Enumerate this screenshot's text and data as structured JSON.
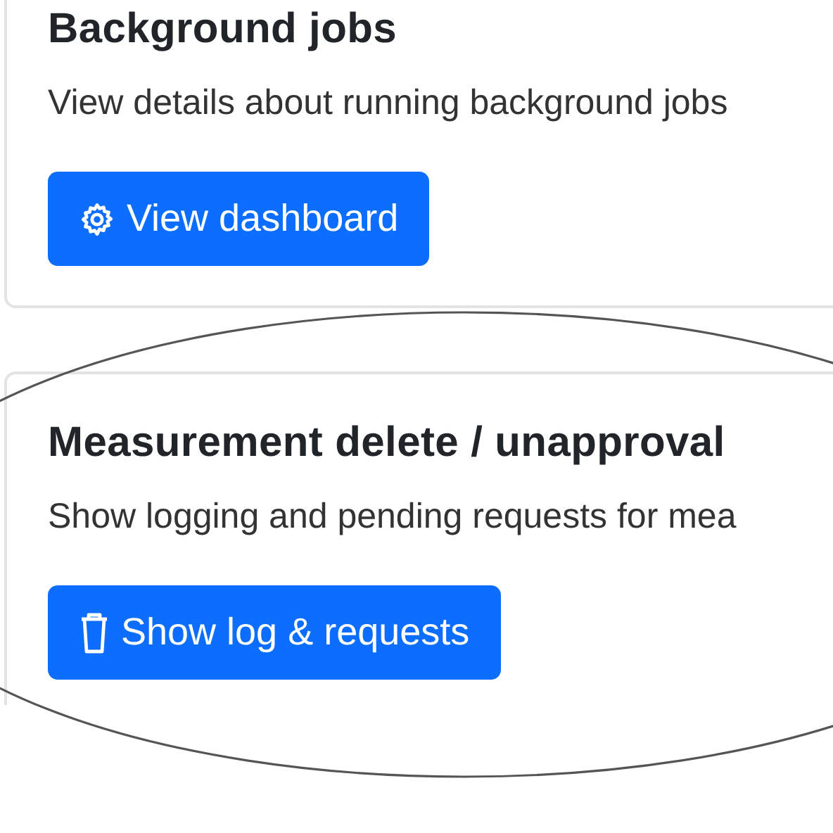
{
  "cards": [
    {
      "title": "Background jobs",
      "description": "View details about running background jobs",
      "button": {
        "label": "View dashboard"
      }
    },
    {
      "title": "Measurement delete / unapproval",
      "description": "Show logging and pending requests for mea",
      "button": {
        "label": "Show log & requests"
      }
    }
  ],
  "annotations": [
    {
      "kind": "ellipse"
    }
  ]
}
